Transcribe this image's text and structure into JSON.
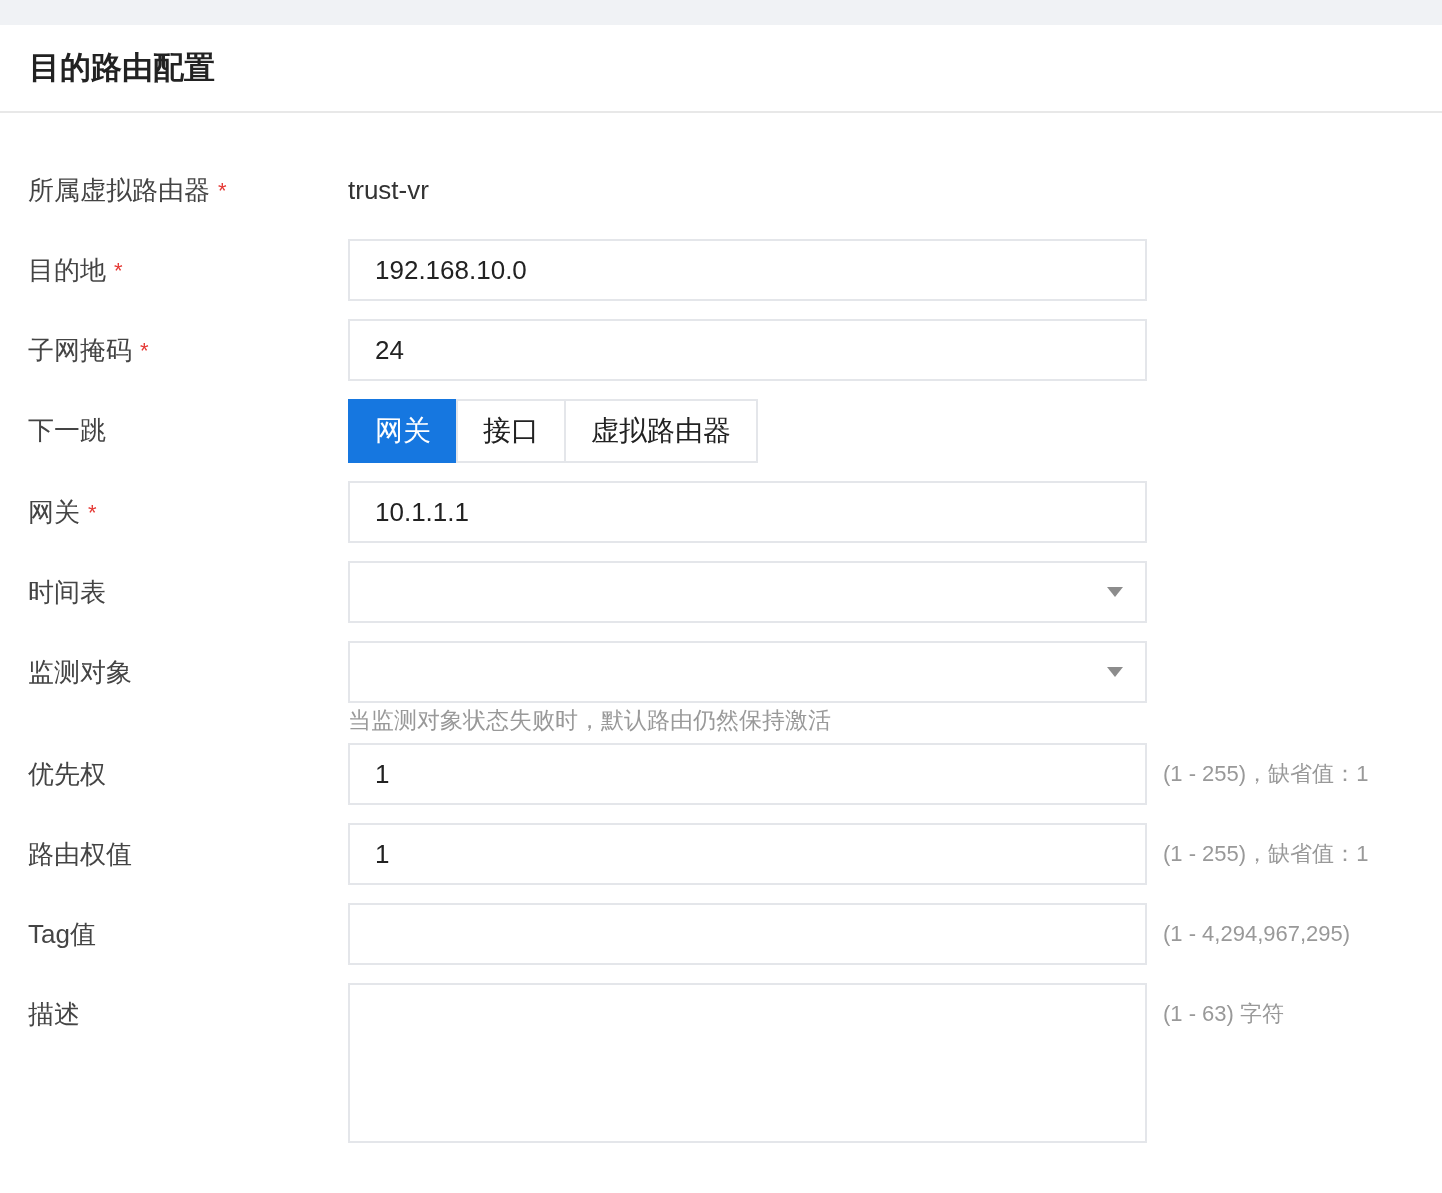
{
  "panel": {
    "title": "目的路由配置"
  },
  "fields": [
    {
      "kind": "text",
      "label": "所属虚拟路由器",
      "marker": "*",
      "value": "trust-vr"
    },
    {
      "kind": "input",
      "label": "目的地",
      "marker": "*",
      "value": "192.168.10.0"
    },
    {
      "kind": "input",
      "label": "子网掩码",
      "marker": "*",
      "value": "24"
    },
    {
      "kind": "segmented",
      "label": "下一跳",
      "options": [
        {
          "label": "网关",
          "selected": true
        },
        {
          "label": "接口",
          "selected": false
        },
        {
          "label": "虚拟路由器",
          "selected": false
        }
      ]
    },
    {
      "kind": "input",
      "label": "网关",
      "marker": "*",
      "value": "10.1.1.1"
    },
    {
      "kind": "select",
      "label": "时间表"
    },
    {
      "kind": "select",
      "label": "监测对象",
      "helper": "当监测对象状态失败时，默认路由仍然保持激活"
    },
    {
      "kind": "input",
      "label": "优先权",
      "value": "1",
      "hint": "(1 - 255)，缺省值：1"
    },
    {
      "kind": "input",
      "label": "路由权值",
      "value": "1",
      "hint": "(1 - 255)，缺省值：1"
    },
    {
      "kind": "input",
      "label": "Tag值",
      "hint": "(1 - 4,294,967,295)"
    },
    {
      "kind": "textarea",
      "label": "描述",
      "hint": "(1 - 63) 字符"
    }
  ]
}
